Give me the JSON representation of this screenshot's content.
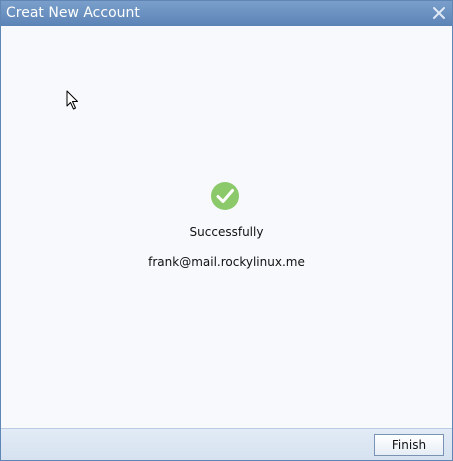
{
  "window": {
    "title": "Creat New Account",
    "close_icon": "close-icon"
  },
  "result": {
    "icon": "check-circle-icon",
    "status": "Successfully",
    "email": "frank@mail.rockylinux.me"
  },
  "footer": {
    "finish_label": "Finish"
  },
  "colors": {
    "titlebar": "#5b83b6",
    "background": "#f7f9fd",
    "success_green": "#8cc96a"
  }
}
